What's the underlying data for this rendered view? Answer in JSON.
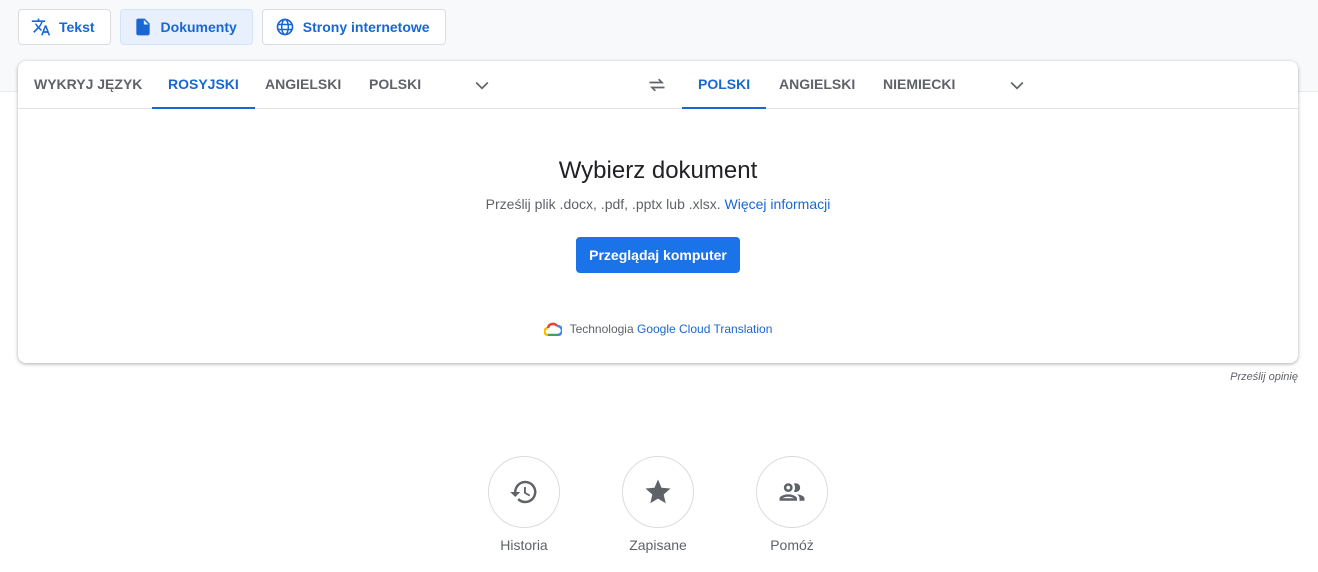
{
  "modes": [
    {
      "label": "Tekst",
      "icon": "translate-icon"
    },
    {
      "label": "Dokumenty",
      "icon": "document-icon",
      "active": true
    },
    {
      "label": "Strony internetowe",
      "icon": "globe-icon"
    }
  ],
  "source_langs": [
    "WYKRYJ JĘZYK",
    "ROSYJSKI",
    "ANGIELSKI",
    "POLSKI"
  ],
  "target_langs": [
    "POLSKI",
    "ANGIELSKI",
    "NIEMIECKI"
  ],
  "main": {
    "title": "Wybierz dokument",
    "subtitle": "Prześlij plik .docx, .pdf, .pptx lub .xlsx.",
    "more_link": "Więcej informacji",
    "browse_button": "Przeglądaj komputer",
    "tech_label": "Technologia",
    "tech_link": "Google Cloud Translation"
  },
  "feedback": "Prześlij opinię",
  "actions": [
    {
      "label": "Historia"
    },
    {
      "label": "Zapisane"
    },
    {
      "label": "Pomóż"
    }
  ]
}
